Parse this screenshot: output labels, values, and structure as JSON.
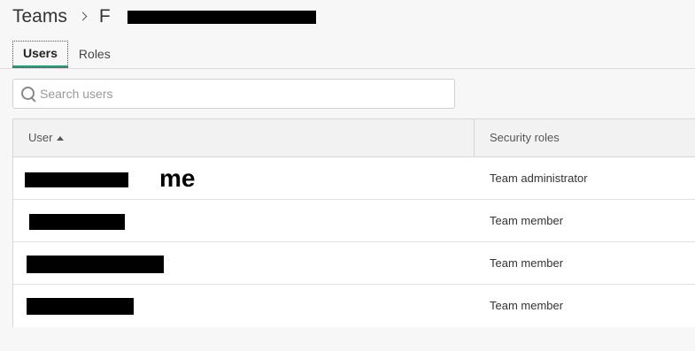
{
  "breadcrumb": {
    "root": "Teams",
    "current": "F"
  },
  "tabs": [
    {
      "label": "Users",
      "active": true
    },
    {
      "label": "Roles",
      "active": false
    }
  ],
  "search": {
    "placeholder": "Search users",
    "value": ""
  },
  "table": {
    "columns": {
      "user": "User",
      "roles": "Security roles"
    },
    "sort": "user-ascending",
    "rows": [
      {
        "user": "",
        "annotation": "me",
        "role": "Team administrator"
      },
      {
        "user": "",
        "role": "Team member"
      },
      {
        "user": "",
        "role": "Team member"
      },
      {
        "user": "",
        "role": "Team member"
      }
    ]
  },
  "colors": {
    "accent": "#1aa47c",
    "redaction": "#000000",
    "background": "#f7f7f7"
  },
  "icons": [
    "chevron-right-icon",
    "search-icon",
    "sort-ascending-icon"
  ]
}
